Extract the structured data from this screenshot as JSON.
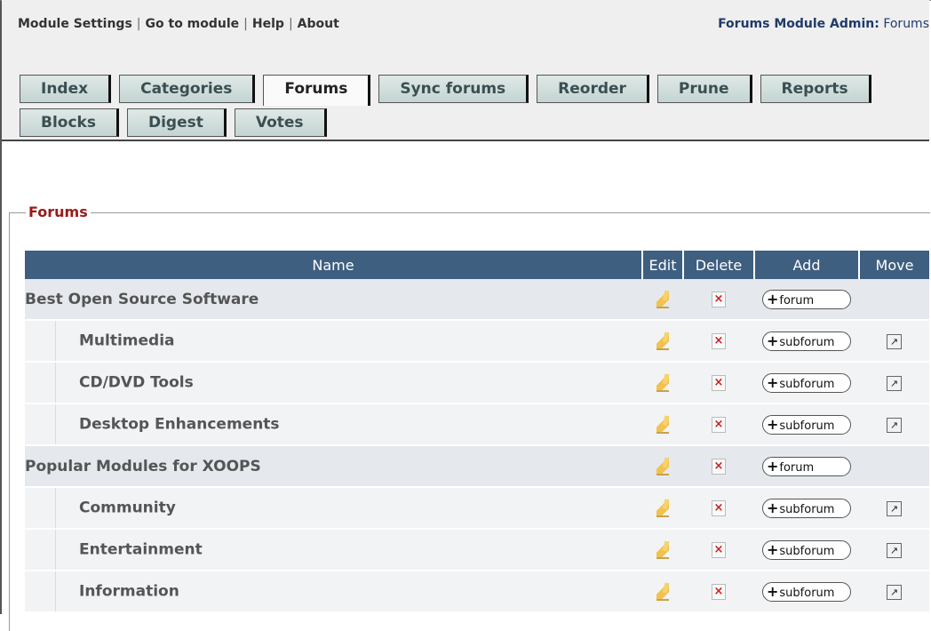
{
  "header": {
    "links": [
      "Module Settings",
      "Go to module",
      "Help",
      "About"
    ],
    "separator": "|",
    "admin_label": "Forums Module Admin:",
    "admin_value": "Forums"
  },
  "tabs": {
    "row1": [
      "Index",
      "Categories",
      "Forums",
      "Sync forums",
      "Reorder",
      "Prune",
      "Reports"
    ],
    "row2": [
      "Blocks",
      "Digest",
      "Votes"
    ],
    "active": "Forums"
  },
  "section": {
    "legend": "Forums"
  },
  "table": {
    "columns": [
      "Name",
      "Edit",
      "Delete",
      "Add",
      "Move"
    ],
    "rows": [
      {
        "name": "Best Open Source Software",
        "level": "category",
        "add": "forum"
      },
      {
        "name": "Multimedia",
        "level": "sub",
        "add": "subforum"
      },
      {
        "name": "CD/DVD Tools",
        "level": "sub",
        "add": "subforum"
      },
      {
        "name": "Desktop Enhancements",
        "level": "sub",
        "add": "subforum"
      },
      {
        "name": "Popular Modules for XOOPS",
        "level": "category",
        "add": "forum"
      },
      {
        "name": "Community",
        "level": "sub",
        "add": "subforum"
      },
      {
        "name": "Entertainment",
        "level": "sub",
        "add": "subforum"
      },
      {
        "name": "Information",
        "level": "sub",
        "add": "subforum"
      }
    ]
  },
  "icons": {
    "edit": "pencil-icon",
    "delete": "delete-icon",
    "move": "move-icon",
    "plus": "+",
    "delete_glyph": "×",
    "move_glyph": "↗"
  },
  "colors": {
    "header_row": "#3e5f80",
    "legend": "#9a1a1a",
    "tab_bg": "#c3d4d2"
  }
}
